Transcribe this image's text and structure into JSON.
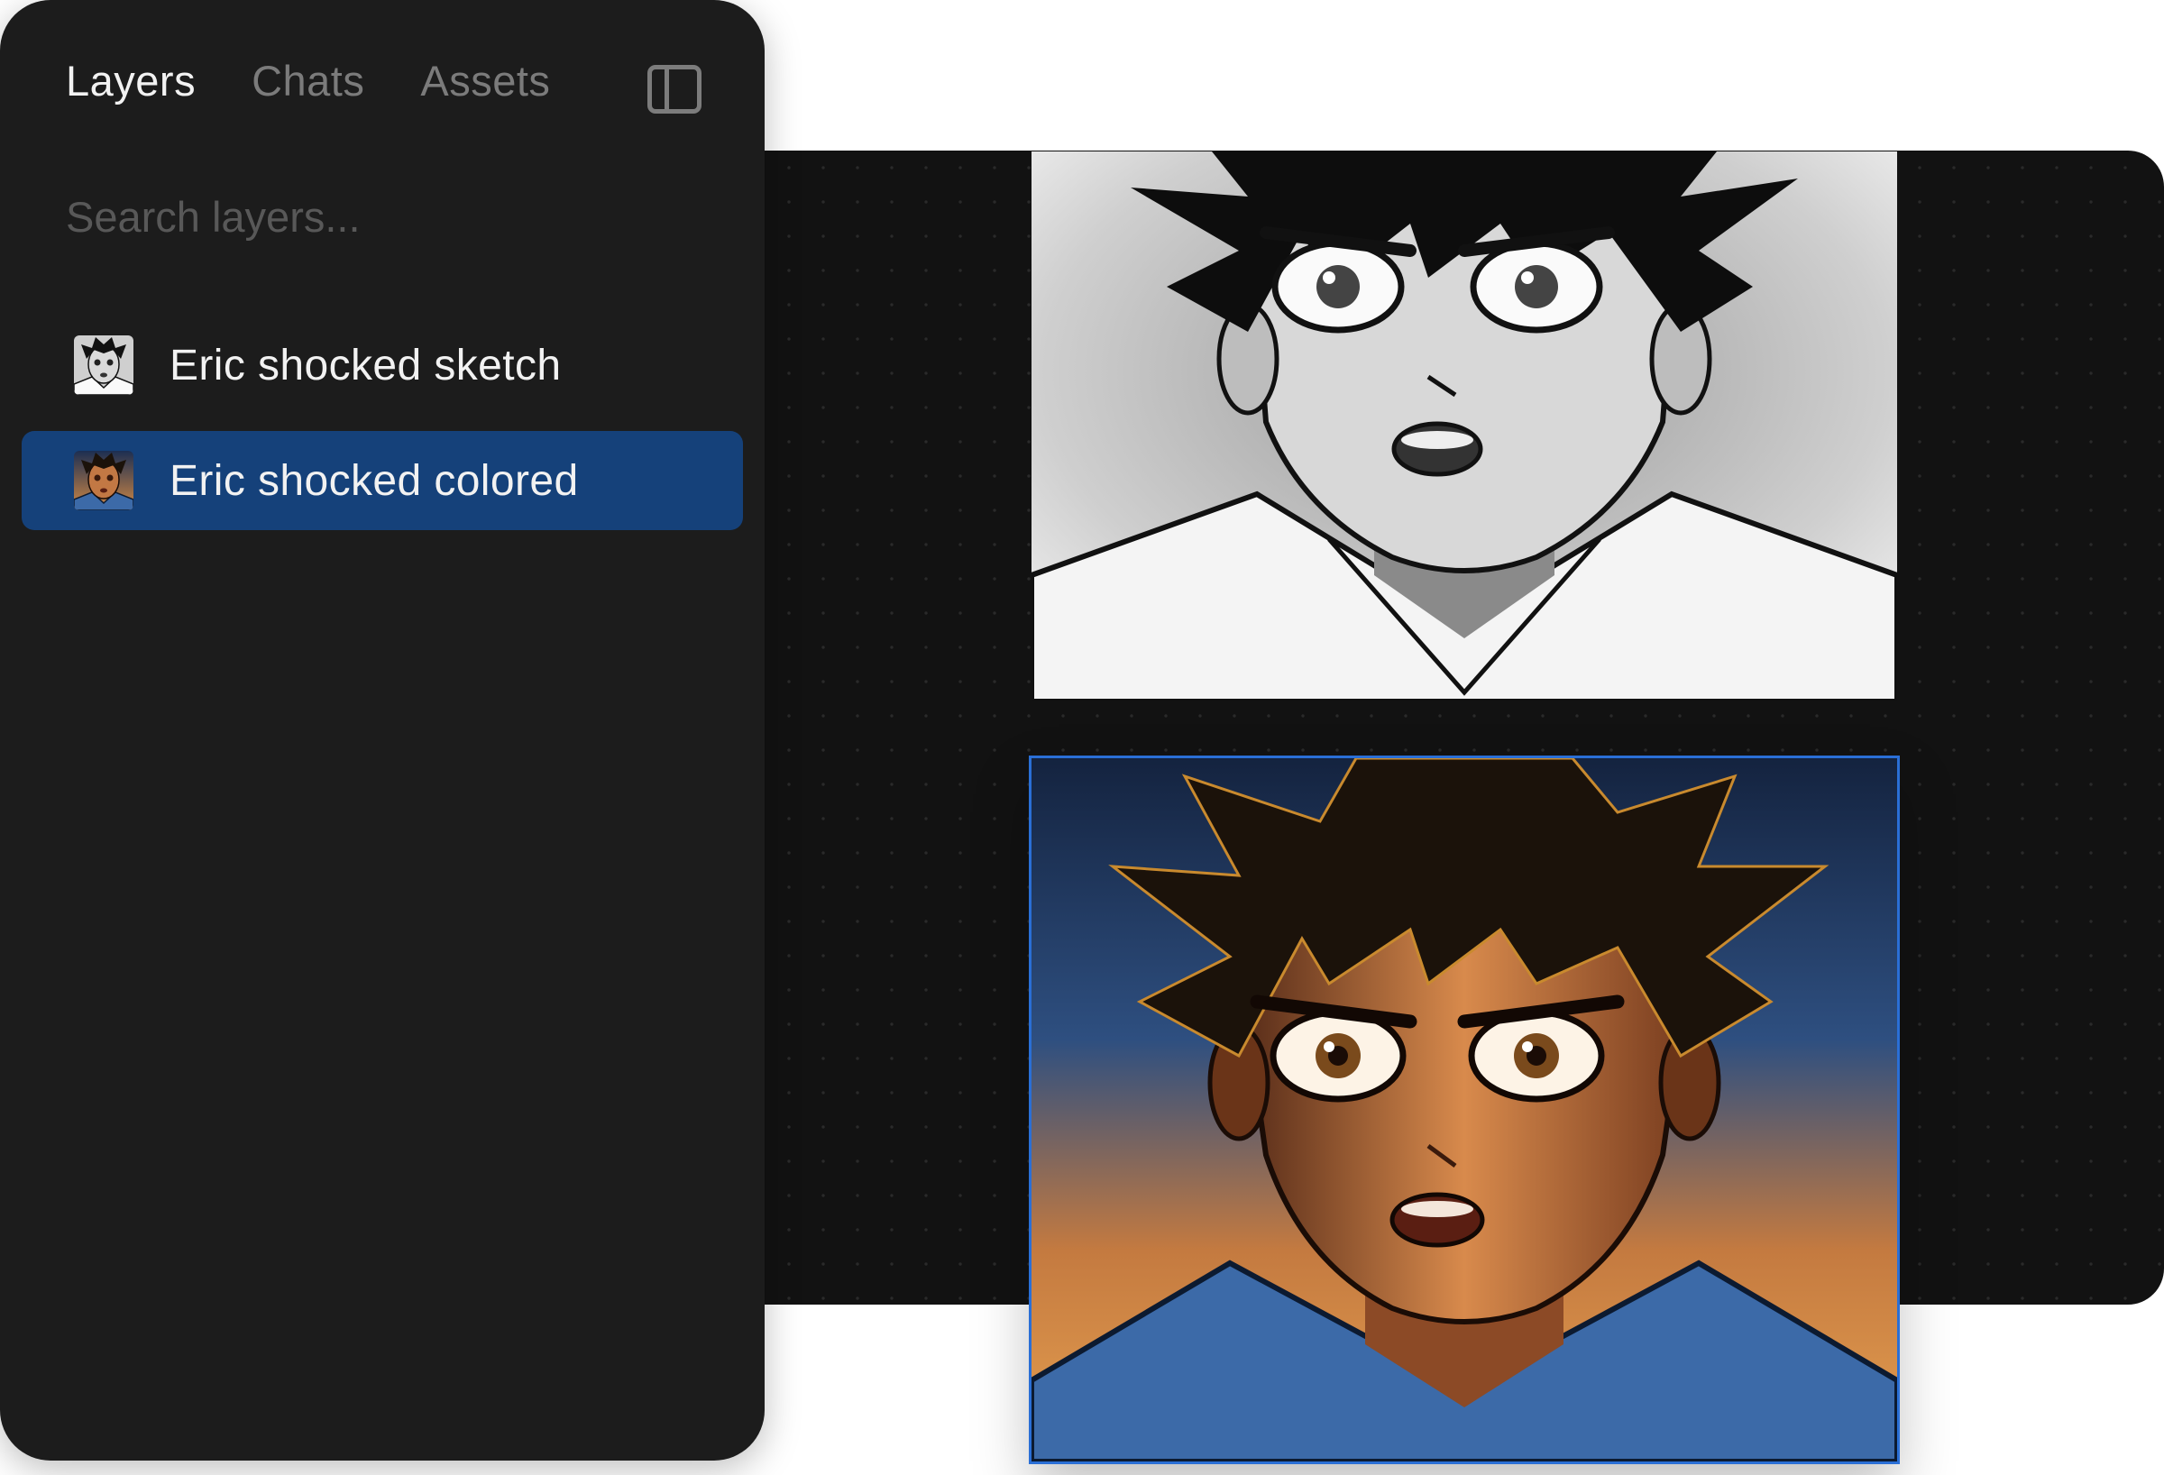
{
  "panel": {
    "tabs": [
      {
        "label": "Layers",
        "active": true
      },
      {
        "label": "Chats",
        "active": false
      },
      {
        "label": "Assets",
        "active": false
      }
    ],
    "toggle_icon": "sidebar-toggle-icon",
    "search": {
      "placeholder": "Search layers...",
      "value": ""
    },
    "layers": [
      {
        "label": "Eric shocked sketch",
        "selected": false,
        "thumbnail": "grayscale-manga-face"
      },
      {
        "label": "Eric shocked colored",
        "selected": true,
        "thumbnail": "colored-manga-face"
      }
    ]
  },
  "canvas": {
    "frames": [
      {
        "name": "Eric shocked sketch",
        "style": "black-and-white manga illustration"
      },
      {
        "name": "Eric shocked colored",
        "style": "colored anime illustration",
        "selected": true
      }
    ]
  },
  "colors": {
    "panel_bg": "#1c1c1c",
    "canvas_bg": "#121212",
    "selection": "#15417a",
    "selection_outline": "#2a6fd6",
    "tab_active": "#f2f2f2",
    "tab_inactive": "#7b7b7b"
  }
}
